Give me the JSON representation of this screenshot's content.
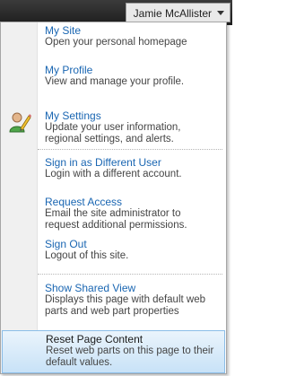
{
  "user_menu": {
    "name": "Jamie McAllister"
  },
  "menu": {
    "items": [
      {
        "title": "My Site",
        "desc": "Open your personal homepage"
      },
      {
        "title": "My Profile",
        "desc": "View and manage your profile."
      },
      {
        "title": "My Settings",
        "desc": "Update your user information, regional settings, and alerts."
      },
      {
        "title": "Sign in as Different User",
        "desc": "Login with a different account."
      },
      {
        "title": "Request Access",
        "desc": "Email the site administrator to request additional permissions."
      },
      {
        "title": "Sign Out",
        "desc": "Logout of this site."
      },
      {
        "title": "Show Shared View",
        "desc": "Displays this page with default web parts and web part properties"
      },
      {
        "title": "Reset Page Content",
        "desc": "Reset web parts on this page to their default values."
      }
    ],
    "icons": {
      "settings": "user-settings-icon"
    }
  }
}
